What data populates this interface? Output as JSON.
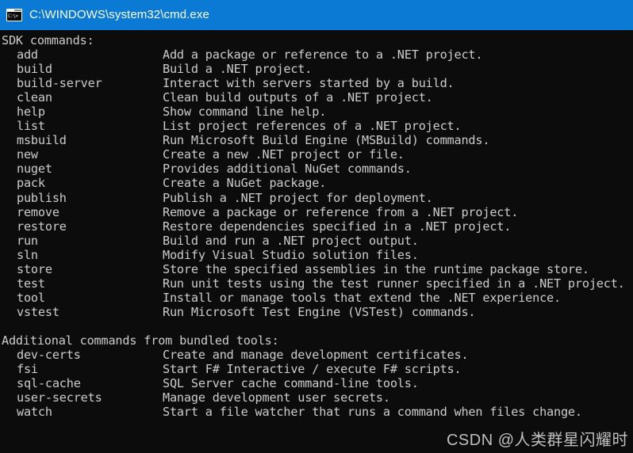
{
  "window": {
    "title": "C:\\WINDOWS\\system32\\cmd.exe",
    "icon_name": "cmd-exe-icon",
    "icon_glyph": "C:\\>",
    "titlebar_color": "#0a7ad4",
    "background_color": "#0c0c0c",
    "text_color": "#cccccc"
  },
  "terminal": {
    "sdk_section_heading": "SDK commands:",
    "sdk_commands": [
      {
        "name": "add",
        "description": "Add a package or reference to a .NET project."
      },
      {
        "name": "build",
        "description": "Build a .NET project."
      },
      {
        "name": "build-server",
        "description": "Interact with servers started by a build."
      },
      {
        "name": "clean",
        "description": "Clean build outputs of a .NET project."
      },
      {
        "name": "help",
        "description": "Show command line help."
      },
      {
        "name": "list",
        "description": "List project references of a .NET project."
      },
      {
        "name": "msbuild",
        "description": "Run Microsoft Build Engine (MSBuild) commands."
      },
      {
        "name": "new",
        "description": "Create a new .NET project or file."
      },
      {
        "name": "nuget",
        "description": "Provides additional NuGet commands."
      },
      {
        "name": "pack",
        "description": "Create a NuGet package."
      },
      {
        "name": "publish",
        "description": "Publish a .NET project for deployment."
      },
      {
        "name": "remove",
        "description": "Remove a package or reference from a .NET project."
      },
      {
        "name": "restore",
        "description": "Restore dependencies specified in a .NET project."
      },
      {
        "name": "run",
        "description": "Build and run a .NET project output."
      },
      {
        "name": "sln",
        "description": "Modify Visual Studio solution files."
      },
      {
        "name": "store",
        "description": "Store the specified assemblies in the runtime package store."
      },
      {
        "name": "test",
        "description": "Run unit tests using the test runner specified in a .NET project."
      },
      {
        "name": "tool",
        "description": "Install or manage tools that extend the .NET experience."
      },
      {
        "name": "vstest",
        "description": "Run Microsoft Test Engine (VSTest) commands."
      }
    ],
    "additional_section_heading": "Additional commands from bundled tools:",
    "additional_commands": [
      {
        "name": "dev-certs",
        "description": "Create and manage development certificates."
      },
      {
        "name": "fsi",
        "description": "Start F# Interactive / execute F# scripts."
      },
      {
        "name": "sql-cache",
        "description": "SQL Server cache command-line tools."
      },
      {
        "name": "user-secrets",
        "description": "Manage development user secrets."
      },
      {
        "name": "watch",
        "description": "Start a file watcher that runs a command when files change."
      }
    ]
  },
  "watermark": {
    "text": "CSDN @人类群星闪耀时"
  }
}
